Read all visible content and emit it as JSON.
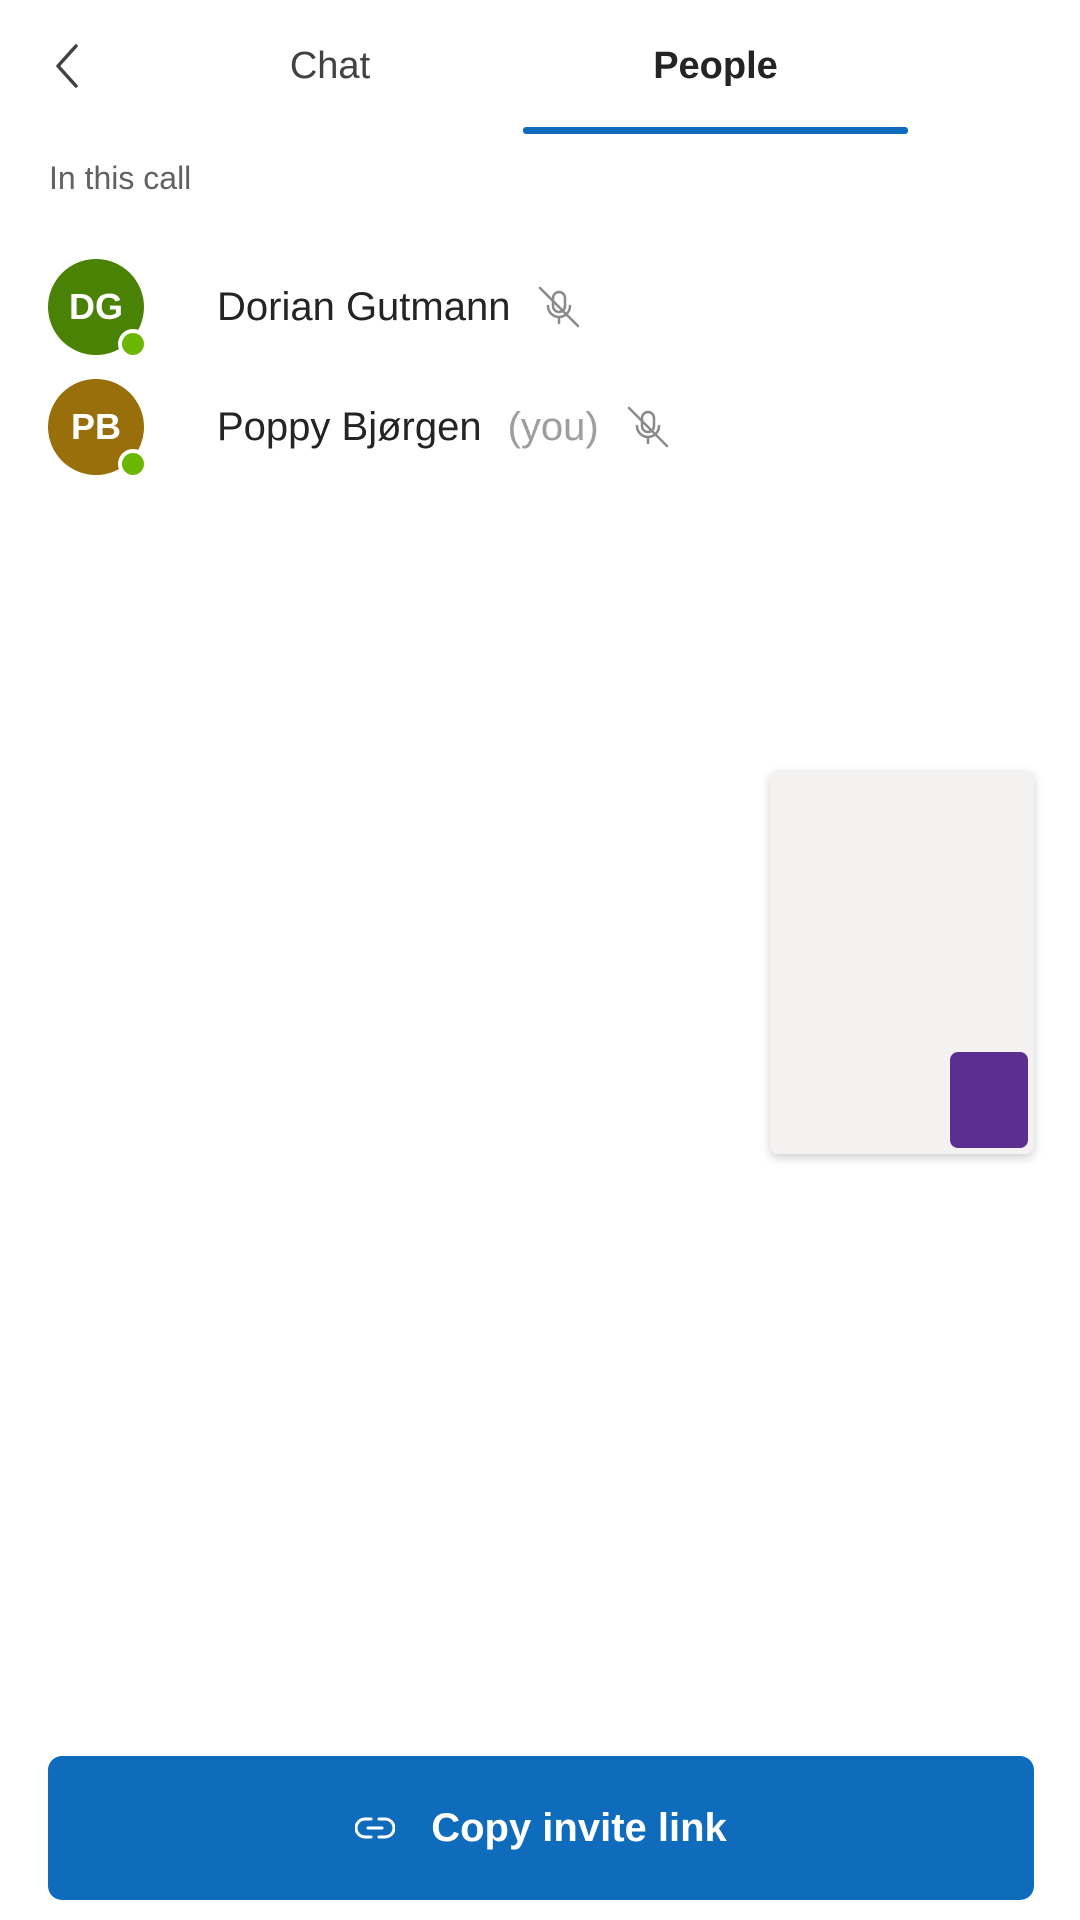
{
  "header": {
    "tabs": [
      {
        "label": "Chat",
        "selected": false
      },
      {
        "label": "People",
        "selected": true
      }
    ],
    "accent_color": "#0f6cbd"
  },
  "section_title": "In this call",
  "participants": [
    {
      "initials": "DG",
      "name": "Dorian Gutmann",
      "suffix": "",
      "avatar_color": "#498205",
      "presence": "available",
      "muted": true
    },
    {
      "initials": "PB",
      "name": "Poppy Bjørgen",
      "suffix": "(you)",
      "avatar_color": "#986f0b",
      "presence": "available",
      "muted": true
    }
  ],
  "invite_button": {
    "label": "Copy invite link",
    "icon": "link-icon"
  }
}
